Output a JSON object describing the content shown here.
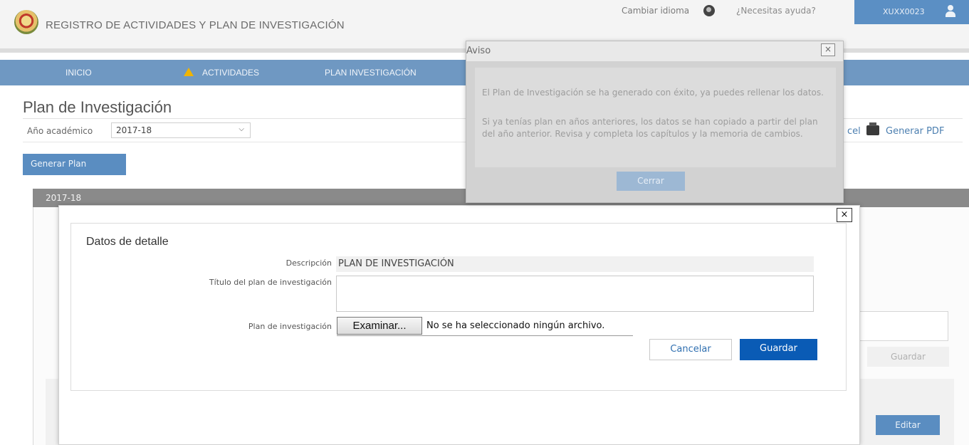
{
  "header": {
    "app_title": "REGISTRO DE ACTIVIDADES Y PLAN DE INVESTIGACIÓN",
    "change_language": "Cambiar idioma",
    "help": "¿Necesitas ayuda?",
    "user": "XUXX0023"
  },
  "nav": {
    "items": [
      {
        "label": "INICIO"
      },
      {
        "label": "ACTIVIDADES"
      },
      {
        "label": "PLAN INVESTIGACIÓN"
      }
    ]
  },
  "page": {
    "title": "Plan de Investigación",
    "year_label": "Año académico",
    "year_value": "2017-18",
    "excel_link": "cel",
    "pdf_link": "Generar PDF",
    "generate_plan": "Generar Plan",
    "year_bar": "2017-18",
    "bg_save": "Guardar",
    "bg_edit": "Editar"
  },
  "detail_dialog": {
    "close": "×",
    "heading": "Datos de detalle",
    "description_label": "Descripción",
    "description_value": "PLAN DE INVESTIGACIÓN",
    "title_label": "Título del plan de investigación",
    "title_value": "",
    "plan_label": "Plan de investigación",
    "browse_label": "Examinar...",
    "file_status": "No se ha seleccionado ningún archivo.",
    "cancel": "Cancelar",
    "save": "Guardar"
  },
  "aviso_dialog": {
    "title": "Aviso",
    "close": "×",
    "message_1": "El Plan de Investigación se ha generado con éxito, ya puedes rellenar los datos.",
    "message_2": "Si ya tenías plan en años anteriores, los datos se han copiado a partir del plan del año anterior. Revisa y completa los capítulos y la memoria de cambios.",
    "close_button": "Cerrar"
  },
  "colors": {
    "nav_bar": "#6f98c2",
    "primary_button": "#0a5bb5",
    "warning": "#f0b400"
  }
}
